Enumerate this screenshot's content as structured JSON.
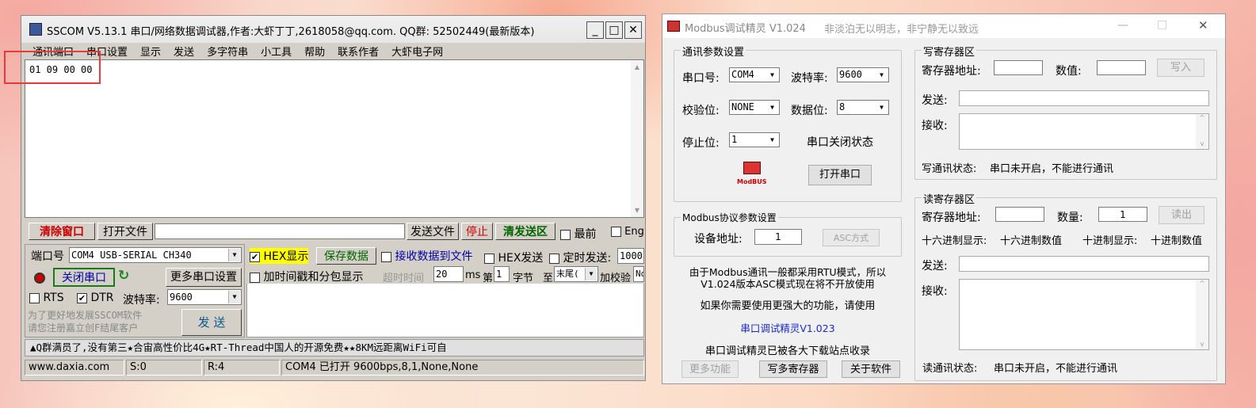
{
  "sscom": {
    "title": "SSCOM V5.13.1 串口/网络数据调试器,作者:大虾丁丁,2618058@qq.com. QQ群: 52502449(最新版本)",
    "window_buttons": [
      "_",
      "□",
      "✕"
    ],
    "menu": [
      "通讯端口",
      "串口设置",
      "显示",
      "发送",
      "多字符串",
      "小工具",
      "帮助",
      "联系作者",
      "大虾电子网"
    ],
    "receive_text": "01 09 00 00",
    "clear_window": "清除窗口",
    "open_file": "打开文件",
    "send_file": "发送文件",
    "stop": "停止",
    "clear_send": "清发送区",
    "topmost": "最前",
    "english": "Eng",
    "port_label": "端口号",
    "port_value": "COM4 USB-SERIAL CH340",
    "hex_display": "HEX显示",
    "save_data": "保存数据",
    "recv_to_file": "接收数据到文件",
    "hex_send": "HEX发送",
    "timed_send": "定时发送:",
    "timed_value": "1000",
    "close_port": "关闭串口",
    "more_settings": "更多串口设置",
    "timestamp_label": "加时间戳和分包显示",
    "timeout_label": "超时时间",
    "timeout_value": "20",
    "ms_label": "ms",
    "nth_label": "第",
    "nth_value": "1",
    "byte_label": "字节",
    "to_label": "至",
    "end_value": "末尾(",
    "checksum_label": "加校验",
    "checksum_value": "No",
    "rts": "RTS",
    "dtr": "DTR",
    "baud_label": "波特率:",
    "baud_value": "9600",
    "promo_line1": "为了更好地发展SSCOM软件",
    "promo_line2": "请您注册嘉立创F结尾客户",
    "send_button": "发 送",
    "ticker": "▲Q群满员了,没有第三★合宙高性价比4G★RT-Thread中国人的开源免费★★8KM远距离WiFi可自",
    "status": [
      "www.daxia.com",
      "S:0",
      "R:4",
      "COM4 已打开  9600bps,8,1,None,None"
    ]
  },
  "modbus": {
    "title": "Modbus调试精灵 V1.024",
    "subtitle": "非淡泊无以明志，非宁静无以致远",
    "comm_group": "通讯参数设置",
    "port_label": "串口号:",
    "port_value": "COM4",
    "baud_label": "波特率:",
    "baud_value": "9600",
    "parity_label": "校验位:",
    "parity_value": "NONE",
    "databits_label": "数据位:",
    "databits_value": "8",
    "stopbits_label": "停止位:",
    "stopbits_value": "1",
    "port_state": "串口关闭状态",
    "modbus_logo": "ModBUS",
    "open_port": "打开串口",
    "proto_group": "Modbus协议参数设置",
    "device_addr_label": "设备地址:",
    "device_addr_value": "1",
    "asc_mode": "ASC方式",
    "note_line1": "由于Modbus通讯一般都采用RTU模式，所以",
    "note_line2": "V1.024版本ASC模式现在将不开放使用",
    "note_line3": "如果你需要使用更强大的功能，请使用",
    "link": "串口调试精灵V1.023",
    "note_line4": "串口调试精灵已被各大下载站点收录",
    "more_funcs": "更多功能",
    "write_multi": "写多寄存器",
    "about": "关于软件",
    "write_group": "写寄存器区",
    "w_addr_label": "寄存器地址:",
    "w_value_label": "数值:",
    "write_btn": "写入",
    "w_send_label": "发送:",
    "w_recv_label": "接收:",
    "w_status_label": "写通讯状态:",
    "w_status": "串口未开启，不能进行通讯",
    "read_group": "读寄存器区",
    "r_addr_label": "寄存器地址:",
    "r_count_label": "数量:",
    "r_count_value": "1",
    "read_btn": "读出",
    "hex_label": "十六进制显示:",
    "hex_value": "十六进制数值",
    "dec_label": "十进制显示:",
    "dec_value": "十进制数值",
    "r_send_label": "发送:",
    "r_recv_label": "接收:",
    "r_status_label": "读通讯状态:",
    "r_status": "串口未开启，不能进行通讯"
  }
}
